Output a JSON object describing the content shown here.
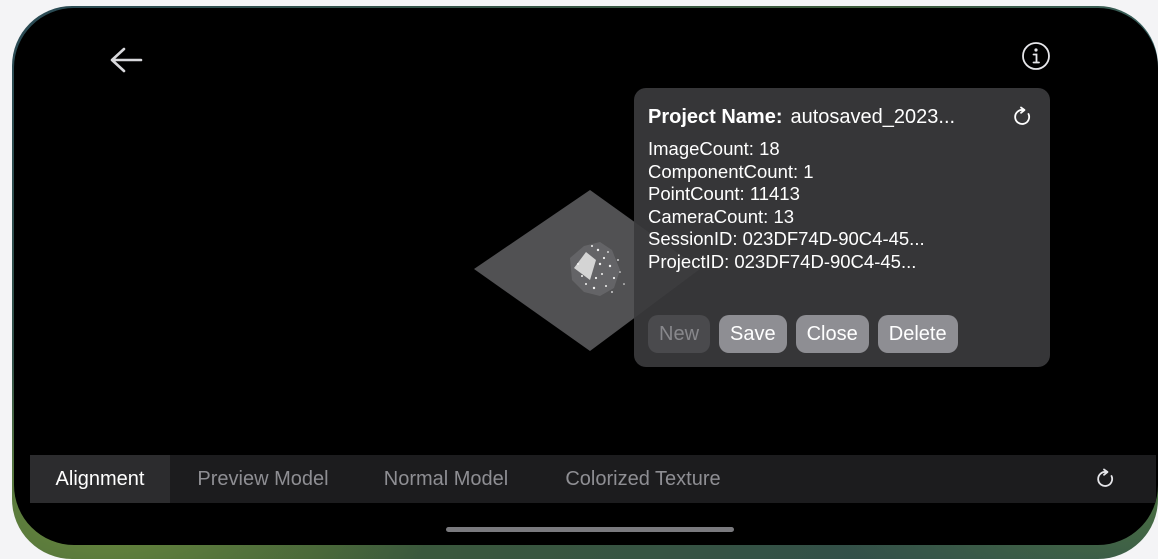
{
  "header": {
    "back_icon": "arrow-left-icon",
    "info_icon": "info-circle-icon"
  },
  "info_panel": {
    "project_label": "Project Name:",
    "project_value": "autosaved_2023...",
    "refresh_icon": "refresh-icon",
    "stats": [
      "ImageCount: 18",
      "ComponentCount: 1",
      "PointCount: 11413",
      "CameraCount: 13",
      "SessionID: 023DF74D-90C4-45...",
      "ProjectID: 023DF74D-90C4-45..."
    ],
    "buttons": {
      "new": "New",
      "save": "Save",
      "close": "Close",
      "delete": "Delete"
    }
  },
  "tabs": [
    {
      "label": "Alignment",
      "active": true
    },
    {
      "label": "Preview Model",
      "active": false
    },
    {
      "label": "Normal Model",
      "active": false
    },
    {
      "label": "Colorized Texture",
      "active": false
    }
  ],
  "tabbar": {
    "refresh_icon": "refresh-icon"
  },
  "colors": {
    "panel_bg": "#3a3a3c",
    "button_bg": "#8e8e93",
    "tabbar_bg": "#1c1c1e",
    "active_tab_bg": "#2c2c2e"
  }
}
